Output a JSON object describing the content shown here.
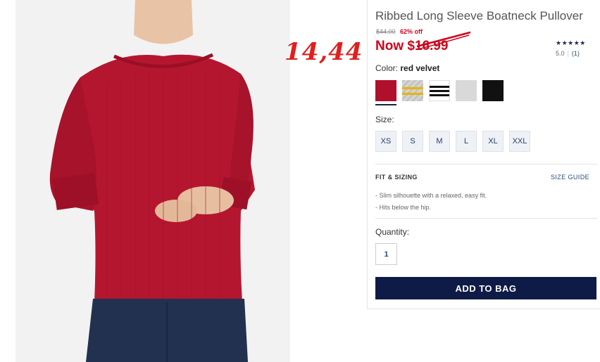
{
  "product": {
    "title": "Ribbed Long Sleeve Boatneck Pullover",
    "original_price": "$44.00",
    "discount": "62% off",
    "now_price": "Now $16.99",
    "rating_stars": "★★★★★",
    "rating_value": "5.0",
    "rating_count": "(1)",
    "annotation": "14,44"
  },
  "color": {
    "label": "Color:",
    "selected_name": "red velvet",
    "swatches": [
      {
        "name": "red-velvet",
        "color": "#b0102c"
      },
      {
        "name": "grey-yellow-stripe",
        "color": "#c9c9c9"
      },
      {
        "name": "white-black-stripe",
        "color": "#ffffff"
      },
      {
        "name": "light-grey",
        "color": "#d9d9d9"
      },
      {
        "name": "black",
        "color": "#111111"
      }
    ]
  },
  "size": {
    "label": "Size:",
    "options": [
      "XS",
      "S",
      "M",
      "L",
      "XL",
      "XXL"
    ]
  },
  "fit": {
    "title": "FIT & SIZING",
    "size_guide": "SIZE GUIDE",
    "bullets": [
      "- Slim silhouette with a relaxed, easy fit.",
      "- Hits below the hip."
    ]
  },
  "quantity": {
    "label": "Quantity:",
    "value": "1"
  },
  "cta": {
    "add_to_bag": "ADD TO BAG"
  },
  "colors": {
    "sale_red": "#d0021b",
    "navy": "#0f1b47",
    "sweater_red": "#b5162f"
  }
}
